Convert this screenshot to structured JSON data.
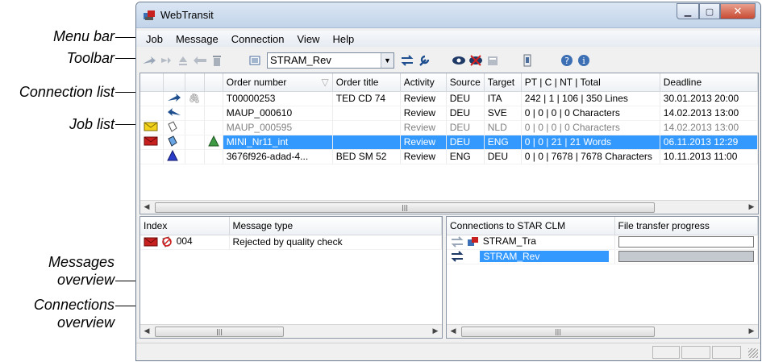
{
  "annotations": {
    "menu_bar": "Menu bar",
    "toolbar": "Toolbar",
    "connection_list": "Connection list",
    "job_list": "Job list",
    "messages_overview_1": "Messages",
    "messages_overview_2": "overview",
    "connections_overview_1": "Connections",
    "connections_overview_2": "overview"
  },
  "window": {
    "title": "WebTransit"
  },
  "menu": [
    "Job",
    "Message",
    "Connection",
    "View",
    "Help"
  ],
  "toolbar": {
    "connection_value": "STRAM_Rev"
  },
  "jobs": {
    "columns": [
      "Order number",
      "Order title",
      "Activity",
      "Source",
      "Target",
      "PT | C | NT | Total",
      "Deadline"
    ],
    "rows": [
      {
        "order_number": "T00000253",
        "order_title": "TED CD 74",
        "activity": "Review",
        "source": "DEU",
        "target": "ITA",
        "counts": "242 | 1 | 106 | 350 Lines",
        "deadline": "30.01.2013 20:00"
      },
      {
        "order_number": "MAUP_000610",
        "order_title": "",
        "activity": "Review",
        "source": "DEU",
        "target": "SVE",
        "counts": "0 | 0 | 0 | 0 Characters",
        "deadline": "14.02.2013 13:00"
      },
      {
        "order_number": "MAUP_000595",
        "order_title": "",
        "activity": "Review",
        "source": "DEU",
        "target": "NLD",
        "counts": "0 | 0 | 0 | 0 Characters",
        "deadline": "14.02.2013 13:00"
      },
      {
        "order_number": "MINI_Nr11_int",
        "order_title": "",
        "activity": "Review",
        "source": "DEU",
        "target": "ENG",
        "counts": "0 | 0 | 21 | 21 Words",
        "deadline": "06.11.2013 12:29"
      },
      {
        "order_number": "3676f926-adad-4...",
        "order_title": "BED SM 52",
        "activity": "Review",
        "source": "ENG",
        "target": "DEU",
        "counts": "0 | 0 | 7678 | 7678 Characters",
        "deadline": "10.11.2013 11:00"
      }
    ]
  },
  "messages": {
    "columns": [
      "Index",
      "Message type"
    ],
    "rows": [
      {
        "index": "004",
        "type": "Rejected by quality check"
      }
    ]
  },
  "connections": {
    "columns": [
      "Connections to STAR CLM",
      "File transfer progress"
    ],
    "rows": [
      {
        "name": "STRAM_Tra",
        "progress": 0
      },
      {
        "name": "STRAM_Rev",
        "progress": 1
      }
    ]
  },
  "colors": {
    "selection": "#3399ff",
    "accent_red": "#c8201e",
    "envelope_yellow": "#f2d21b"
  }
}
